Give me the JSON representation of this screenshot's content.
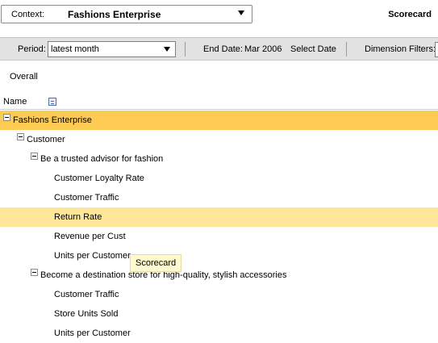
{
  "context": {
    "label": "Context:",
    "value": "Fashions Enterprise"
  },
  "page_title": "Scorecard",
  "toolbar": {
    "period_label": "Period:",
    "period_value": "latest month",
    "end_date_label": "End Date:",
    "end_date_value": "Mar 2006",
    "select_date": "Select Date",
    "dimension_filters": "Dimension Filters:"
  },
  "tabs": {
    "overall": "Overall"
  },
  "grid": {
    "name_header": "Name",
    "rows": [
      {
        "label": "Fashions Enterprise",
        "level": 0,
        "expanded": true
      },
      {
        "label": "Customer",
        "level": 1,
        "expanded": true
      },
      {
        "label": "Be a trusted advisor for fashion",
        "level": 2,
        "expanded": true
      },
      {
        "label": "Customer Loyalty Rate",
        "level": 3
      },
      {
        "label": "Customer Traffic",
        "level": 3
      },
      {
        "label": "Return Rate",
        "level": 3
      },
      {
        "label": "Revenue per Cust",
        "level": 3
      },
      {
        "label": "Units per Customer",
        "level": 3
      },
      {
        "label": "Become a destination store for high-quality, stylish accessories",
        "level": 2,
        "expanded": true
      },
      {
        "label": "Customer Traffic",
        "level": 3
      },
      {
        "label": "Store Units Sold",
        "level": 3
      },
      {
        "label": "Units per Customer",
        "level": 3
      }
    ]
  },
  "tooltip": "Scorecard",
  "colors": {
    "selected_row": "#fdca54",
    "hover_row": "#fde59a",
    "toolbar_bg": "#e2e2e2"
  }
}
